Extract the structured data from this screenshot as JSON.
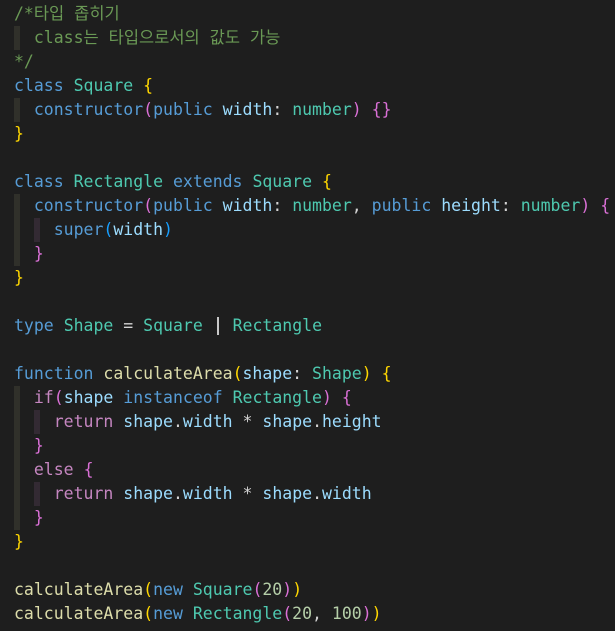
{
  "editor": {
    "language": "typescript",
    "theme": "dark",
    "lines": [
      {
        "indent": 0,
        "tokens": [
          {
            "t": "/*타입 좁히기",
            "c": "comment"
          }
        ]
      },
      {
        "indent": 1,
        "tokens": [
          {
            "t": "class는 타입으로서의 값도 가능",
            "c": "comment"
          }
        ]
      },
      {
        "indent": 0,
        "tokens": [
          {
            "t": "*/",
            "c": "comment"
          }
        ]
      },
      {
        "indent": 0,
        "tokens": [
          {
            "t": "class",
            "c": "kw"
          },
          {
            "t": " "
          },
          {
            "t": "Square",
            "c": "cls"
          },
          {
            "t": " "
          },
          {
            "t": "{",
            "c": "b1"
          }
        ]
      },
      {
        "indent": 1,
        "tokens": [
          {
            "t": "constructor",
            "c": "kw"
          },
          {
            "t": "(",
            "c": "b2"
          },
          {
            "t": "public",
            "c": "kw"
          },
          {
            "t": " "
          },
          {
            "t": "width",
            "c": "param"
          },
          {
            "t": ": "
          },
          {
            "t": "number",
            "c": "cls"
          },
          {
            "t": ")",
            "c": "b2"
          },
          {
            "t": " "
          },
          {
            "t": "{}",
            "c": "b2"
          }
        ]
      },
      {
        "indent": 0,
        "tokens": [
          {
            "t": "}",
            "c": "b1"
          }
        ]
      },
      {
        "indent": 0,
        "tokens": []
      },
      {
        "indent": 0,
        "tokens": [
          {
            "t": "class",
            "c": "kw"
          },
          {
            "t": " "
          },
          {
            "t": "Rectangle",
            "c": "cls"
          },
          {
            "t": " "
          },
          {
            "t": "extends",
            "c": "kw"
          },
          {
            "t": " "
          },
          {
            "t": "Square",
            "c": "cls"
          },
          {
            "t": " "
          },
          {
            "t": "{",
            "c": "b1"
          }
        ]
      },
      {
        "indent": 1,
        "tokens": [
          {
            "t": "constructor",
            "c": "kw"
          },
          {
            "t": "(",
            "c": "b2"
          },
          {
            "t": "public",
            "c": "kw"
          },
          {
            "t": " "
          },
          {
            "t": "width",
            "c": "param"
          },
          {
            "t": ": "
          },
          {
            "t": "number",
            "c": "cls"
          },
          {
            "t": ", "
          },
          {
            "t": "public",
            "c": "kw"
          },
          {
            "t": " "
          },
          {
            "t": "height",
            "c": "param"
          },
          {
            "t": ": "
          },
          {
            "t": "number",
            "c": "cls"
          },
          {
            "t": ")",
            "c": "b2"
          },
          {
            "t": " "
          },
          {
            "t": "{",
            "c": "b2"
          }
        ]
      },
      {
        "indent": 2,
        "tokens": [
          {
            "t": "super",
            "c": "kw"
          },
          {
            "t": "(",
            "c": "b3"
          },
          {
            "t": "width",
            "c": "param"
          },
          {
            "t": ")",
            "c": "b3"
          }
        ]
      },
      {
        "indent": 1,
        "tokens": [
          {
            "t": "}",
            "c": "b2"
          }
        ]
      },
      {
        "indent": 0,
        "tokens": [
          {
            "t": "}",
            "c": "b1"
          }
        ]
      },
      {
        "indent": 0,
        "tokens": []
      },
      {
        "indent": 0,
        "cursorAfterToken": 6,
        "tokens": [
          {
            "t": "type",
            "c": "kw"
          },
          {
            "t": " "
          },
          {
            "t": "Shape",
            "c": "cls"
          },
          {
            "t": " "
          },
          {
            "t": "=",
            "c": "op"
          },
          {
            "t": " "
          },
          {
            "t": "Square",
            "c": "cls"
          },
          {
            "t": "   "
          },
          {
            "t": "Rectangle",
            "c": "cls"
          }
        ]
      },
      {
        "indent": 0,
        "tokens": []
      },
      {
        "indent": 0,
        "tokens": [
          {
            "t": "function",
            "c": "kw"
          },
          {
            "t": " "
          },
          {
            "t": "calculateArea",
            "c": "fn"
          },
          {
            "t": "(",
            "c": "b1"
          },
          {
            "t": "shape",
            "c": "param"
          },
          {
            "t": ": "
          },
          {
            "t": "Shape",
            "c": "cls"
          },
          {
            "t": ")",
            "c": "b1"
          },
          {
            "t": " "
          },
          {
            "t": "{",
            "c": "b1"
          }
        ]
      },
      {
        "indent": 1,
        "tokens": [
          {
            "t": "if",
            "c": "ctrl"
          },
          {
            "t": "(",
            "c": "b2"
          },
          {
            "t": "shape",
            "c": "param"
          },
          {
            "t": " "
          },
          {
            "t": "instanceof",
            "c": "kw"
          },
          {
            "t": " "
          },
          {
            "t": "Rectangle",
            "c": "cls"
          },
          {
            "t": ")",
            "c": "b2"
          },
          {
            "t": " "
          },
          {
            "t": "{",
            "c": "b2"
          }
        ]
      },
      {
        "indent": 2,
        "tokens": [
          {
            "t": "return",
            "c": "ctrl"
          },
          {
            "t": " "
          },
          {
            "t": "shape",
            "c": "param"
          },
          {
            "t": "."
          },
          {
            "t": "width",
            "c": "param"
          },
          {
            "t": " "
          },
          {
            "t": "*",
            "c": "op"
          },
          {
            "t": " "
          },
          {
            "t": "shape",
            "c": "param"
          },
          {
            "t": "."
          },
          {
            "t": "height",
            "c": "param"
          }
        ]
      },
      {
        "indent": 1,
        "tokens": [
          {
            "t": "}",
            "c": "b2"
          }
        ]
      },
      {
        "indent": 1,
        "tokens": [
          {
            "t": "else",
            "c": "ctrl"
          },
          {
            "t": " "
          },
          {
            "t": "{",
            "c": "b2"
          }
        ]
      },
      {
        "indent": 2,
        "tokens": [
          {
            "t": "return",
            "c": "ctrl"
          },
          {
            "t": " "
          },
          {
            "t": "shape",
            "c": "param"
          },
          {
            "t": "."
          },
          {
            "t": "width",
            "c": "param"
          },
          {
            "t": " "
          },
          {
            "t": "*",
            "c": "op"
          },
          {
            "t": " "
          },
          {
            "t": "shape",
            "c": "param"
          },
          {
            "t": "."
          },
          {
            "t": "width",
            "c": "param"
          }
        ]
      },
      {
        "indent": 1,
        "tokens": [
          {
            "t": "}",
            "c": "b2"
          }
        ]
      },
      {
        "indent": 0,
        "tokens": [
          {
            "t": "}",
            "c": "b1"
          }
        ]
      },
      {
        "indent": 0,
        "tokens": []
      },
      {
        "indent": 0,
        "tokens": [
          {
            "t": "calculateArea",
            "c": "fn"
          },
          {
            "t": "(",
            "c": "b1"
          },
          {
            "t": "new",
            "c": "kw"
          },
          {
            "t": " "
          },
          {
            "t": "Square",
            "c": "cls"
          },
          {
            "t": "(",
            "c": "b2"
          },
          {
            "t": "20",
            "c": "num"
          },
          {
            "t": ")",
            "c": "b2"
          },
          {
            "t": ")",
            "c": "b1"
          }
        ]
      },
      {
        "indent": 0,
        "tokens": [
          {
            "t": "calculateArea",
            "c": "fn"
          },
          {
            "t": "(",
            "c": "b1"
          },
          {
            "t": "new",
            "c": "kw"
          },
          {
            "t": " "
          },
          {
            "t": "Rectangle",
            "c": "cls"
          },
          {
            "t": "(",
            "c": "b2"
          },
          {
            "t": "20",
            "c": "num"
          },
          {
            "t": ", "
          },
          {
            "t": "100",
            "c": "num"
          },
          {
            "t": ")",
            "c": "b2"
          },
          {
            "t": ")",
            "c": "b1"
          }
        ]
      }
    ]
  }
}
